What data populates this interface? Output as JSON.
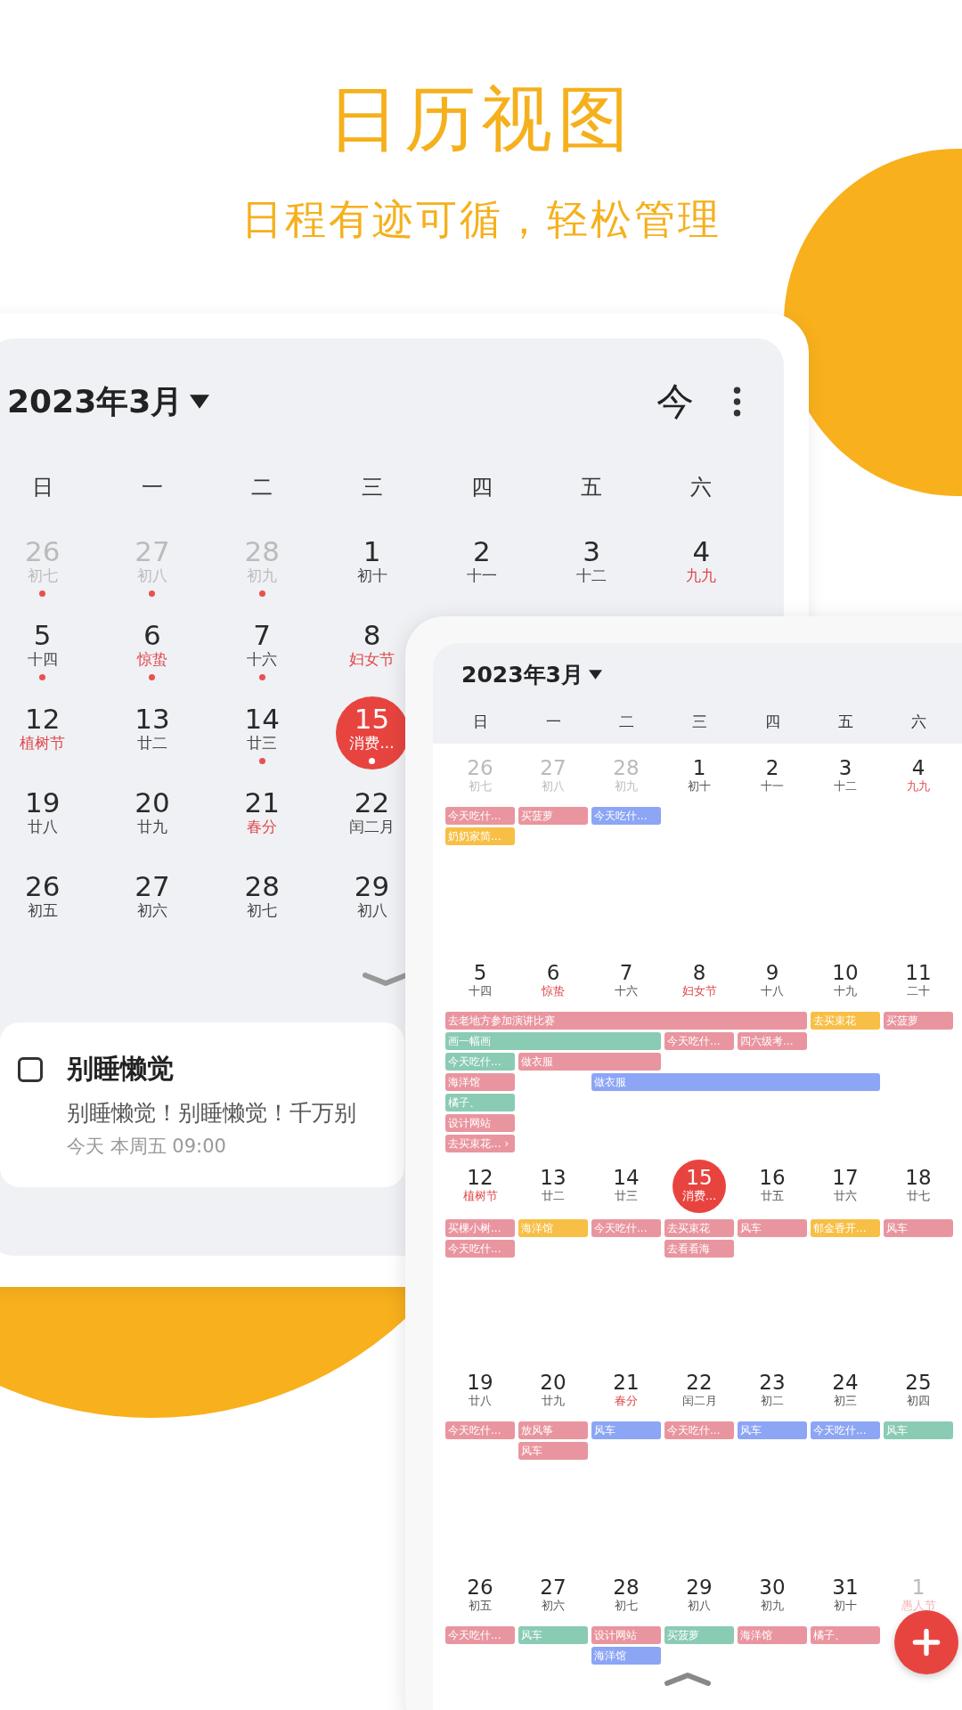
{
  "headline": "日历视图",
  "subheadline": "日程有迹可循，轻松管理",
  "month_view": {
    "title": "2023年3月",
    "today_button": "今",
    "weekdays": [
      "日",
      "一",
      "二",
      "三",
      "四",
      "五",
      "六"
    ],
    "weeks": [
      [
        {
          "day": "26",
          "lunar": "初七",
          "festival": false,
          "other_month": true,
          "dot": true,
          "selected": false
        },
        {
          "day": "27",
          "lunar": "初八",
          "festival": false,
          "other_month": true,
          "dot": true,
          "selected": false
        },
        {
          "day": "28",
          "lunar": "初九",
          "festival": false,
          "other_month": true,
          "dot": true,
          "selected": false
        },
        {
          "day": "1",
          "lunar": "初十",
          "festival": false,
          "other_month": false,
          "dot": false,
          "selected": false
        },
        {
          "day": "2",
          "lunar": "十一",
          "festival": false,
          "other_month": false,
          "dot": false,
          "selected": false
        },
        {
          "day": "3",
          "lunar": "十二",
          "festival": false,
          "other_month": false,
          "dot": false,
          "selected": false
        },
        {
          "day": "4",
          "lunar": "九九",
          "festival": true,
          "other_month": false,
          "dot": false,
          "selected": false
        }
      ],
      [
        {
          "day": "5",
          "lunar": "十四",
          "festival": false,
          "other_month": false,
          "dot": true,
          "selected": false
        },
        {
          "day": "6",
          "lunar": "惊蛰",
          "festival": true,
          "other_month": false,
          "dot": true,
          "selected": false
        },
        {
          "day": "7",
          "lunar": "十六",
          "festival": false,
          "other_month": false,
          "dot": true,
          "selected": false
        },
        {
          "day": "8",
          "lunar": "妇女节",
          "festival": true,
          "other_month": false,
          "dot": false,
          "selected": false
        }
      ],
      [
        {
          "day": "12",
          "lunar": "植树节",
          "festival": true,
          "other_month": false,
          "dot": false,
          "selected": false
        },
        {
          "day": "13",
          "lunar": "廿二",
          "festival": false,
          "other_month": false,
          "dot": false,
          "selected": false
        },
        {
          "day": "14",
          "lunar": "廿三",
          "festival": false,
          "other_month": false,
          "dot": true,
          "selected": false
        },
        {
          "day": "15",
          "lunar": "消费...",
          "festival": false,
          "other_month": false,
          "dot": true,
          "selected": true
        }
      ],
      [
        {
          "day": "19",
          "lunar": "廿八",
          "festival": false,
          "other_month": false,
          "dot": false,
          "selected": false
        },
        {
          "day": "20",
          "lunar": "廿九",
          "festival": false,
          "other_month": false,
          "dot": false,
          "selected": false
        },
        {
          "day": "21",
          "lunar": "春分",
          "festival": true,
          "other_month": false,
          "dot": false,
          "selected": false
        },
        {
          "day": "22",
          "lunar": "闰二月",
          "festival": false,
          "other_month": false,
          "dot": false,
          "selected": false
        }
      ],
      [
        {
          "day": "26",
          "lunar": "初五",
          "festival": false,
          "other_month": false,
          "dot": false,
          "selected": false
        },
        {
          "day": "27",
          "lunar": "初六",
          "festival": false,
          "other_month": false,
          "dot": false,
          "selected": false
        },
        {
          "day": "28",
          "lunar": "初七",
          "festival": false,
          "other_month": false,
          "dot": false,
          "selected": false
        },
        {
          "day": "29",
          "lunar": "初八",
          "festival": false,
          "other_month": false,
          "dot": false,
          "selected": false
        }
      ]
    ],
    "todo": {
      "checked": false,
      "title": "别睡懒觉",
      "description": "别睡懒觉！别睡懒觉！千万别",
      "time": "今天 本周五 09:00"
    }
  },
  "agenda_view": {
    "title": "2023年3月",
    "weekdays": [
      "日",
      "一",
      "二",
      "三",
      "四",
      "五",
      "六"
    ],
    "weeks": [
      {
        "days": [
          {
            "day": "26",
            "lunar": "初七",
            "festival": false,
            "other_month": true,
            "selected": false
          },
          {
            "day": "27",
            "lunar": "初八",
            "festival": false,
            "other_month": true,
            "selected": false
          },
          {
            "day": "28",
            "lunar": "初九",
            "festival": false,
            "other_month": true,
            "selected": false
          },
          {
            "day": "1",
            "lunar": "初十",
            "festival": false,
            "other_month": false,
            "selected": false
          },
          {
            "day": "2",
            "lunar": "十一",
            "festival": false,
            "other_month": false,
            "selected": false
          },
          {
            "day": "3",
            "lunar": "十二",
            "festival": false,
            "other_month": false,
            "selected": false
          },
          {
            "day": "4",
            "lunar": "九九",
            "festival": true,
            "other_month": false,
            "selected": false
          }
        ],
        "lanes": [
          [
            {
              "kind": "event",
              "text": "今天吃什...",
              "color": "#e9959f"
            },
            {
              "kind": "event",
              "text": "买菠萝",
              "color": "#e9959f"
            },
            {
              "kind": "event",
              "text": "今天吃什...",
              "color": "#8ca5f5"
            }
          ],
          [
            {
              "kind": "event",
              "text": "奶奶家简...",
              "color": "#f7bf45"
            }
          ]
        ]
      },
      {
        "days": [
          {
            "day": "5",
            "lunar": "十四",
            "festival": false,
            "other_month": false,
            "selected": false
          },
          {
            "day": "6",
            "lunar": "惊蛰",
            "festival": true,
            "other_month": false,
            "selected": false
          },
          {
            "day": "7",
            "lunar": "十六",
            "festival": false,
            "other_month": false,
            "selected": false
          },
          {
            "day": "8",
            "lunar": "妇女节",
            "festival": true,
            "other_month": false,
            "selected": false
          },
          {
            "day": "9",
            "lunar": "十八",
            "festival": false,
            "other_month": false,
            "selected": false
          },
          {
            "day": "10",
            "lunar": "十九",
            "festival": false,
            "other_month": false,
            "selected": false
          },
          {
            "day": "11",
            "lunar": "二十",
            "festival": false,
            "other_month": false,
            "selected": false
          }
        ],
        "lanes": [
          [
            {
              "kind": "event",
              "text": "去老地方参加演讲比赛",
              "color": "#e9959f"
            },
            {
              "kind": "continued"
            },
            {
              "kind": "continued"
            },
            {
              "kind": "continued"
            },
            {
              "kind": "continued"
            },
            {
              "kind": "event",
              "text": "去买束花",
              "color": "#f7bf45"
            },
            {
              "kind": "event",
              "text": "买菠萝",
              "color": "#e9959f"
            }
          ],
          [
            {
              "kind": "event",
              "text": "画一幅画",
              "color": "#8acbb4"
            },
            {
              "kind": "continued"
            },
            {
              "kind": "continued"
            },
            {
              "kind": "event",
              "text": "今天吃什...",
              "color": "#e9959f"
            },
            {
              "kind": "event",
              "text": "四六级考...",
              "color": "#e9959f"
            }
          ],
          [
            {
              "kind": "event",
              "text": "今天吃什...",
              "color": "#8acbb4"
            },
            {
              "kind": "event",
              "text": "做衣服",
              "color": "#e9959f"
            },
            {
              "kind": "continued"
            }
          ],
          [
            {
              "kind": "event",
              "text": "海洋馆",
              "color": "#e9959f"
            },
            {
              "kind": "empty"
            },
            {
              "kind": "event",
              "text": "做衣服",
              "color": "#8ca5f5"
            },
            {
              "kind": "continued"
            },
            {
              "kind": "continued"
            },
            {
              "kind": "continued"
            }
          ],
          [
            {
              "kind": "event",
              "text": "橘子、",
              "color": "#8acbb4"
            }
          ],
          [
            {
              "kind": "event",
              "text": "设计网站",
              "color": "#e9959f"
            }
          ],
          [
            {
              "kind": "event",
              "text": "去买束花...",
              "more": "›",
              "color": "#e9959f"
            }
          ]
        ]
      },
      {
        "days": [
          {
            "day": "12",
            "lunar": "植树节",
            "festival": true,
            "other_month": false,
            "selected": false
          },
          {
            "day": "13",
            "lunar": "廿二",
            "festival": false,
            "other_month": false,
            "selected": false
          },
          {
            "day": "14",
            "lunar": "廿三",
            "festival": false,
            "other_month": false,
            "selected": false
          },
          {
            "day": "15",
            "lunar": "消费...",
            "festival": false,
            "other_month": false,
            "selected": true
          },
          {
            "day": "16",
            "lunar": "廿五",
            "festival": false,
            "other_month": false,
            "selected": false
          },
          {
            "day": "17",
            "lunar": "廿六",
            "festival": false,
            "other_month": false,
            "selected": false
          },
          {
            "day": "18",
            "lunar": "廿七",
            "festival": false,
            "other_month": false,
            "selected": false
          }
        ],
        "lanes": [
          [
            {
              "kind": "event",
              "text": "买棵小树...",
              "color": "#e9959f"
            },
            {
              "kind": "event",
              "text": "海洋馆",
              "color": "#f7bf45"
            },
            {
              "kind": "event",
              "text": "今天吃什...",
              "color": "#e9959f"
            },
            {
              "kind": "event",
              "text": "去买束花",
              "color": "#e9959f"
            },
            {
              "kind": "event",
              "text": "风车",
              "color": "#e9959f"
            },
            {
              "kind": "event",
              "text": "郁金香开...",
              "color": "#f7bf45"
            },
            {
              "kind": "event",
              "text": "风车",
              "color": "#e9959f"
            }
          ],
          [
            {
              "kind": "event",
              "text": "今天吃什...",
              "color": "#e9959f"
            },
            {
              "kind": "empty"
            },
            {
              "kind": "empty"
            },
            {
              "kind": "event",
              "text": "去看看海",
              "color": "#e9959f"
            }
          ]
        ]
      },
      {
        "days": [
          {
            "day": "19",
            "lunar": "廿八",
            "festival": false,
            "other_month": false,
            "selected": false
          },
          {
            "day": "20",
            "lunar": "廿九",
            "festival": false,
            "other_month": false,
            "selected": false
          },
          {
            "day": "21",
            "lunar": "春分",
            "festival": true,
            "other_month": false,
            "selected": false
          },
          {
            "day": "22",
            "lunar": "闰二月",
            "festival": false,
            "other_month": false,
            "selected": false
          },
          {
            "day": "23",
            "lunar": "初二",
            "festival": false,
            "other_month": false,
            "selected": false
          },
          {
            "day": "24",
            "lunar": "初三",
            "festival": false,
            "other_month": false,
            "selected": false
          },
          {
            "day": "25",
            "lunar": "初四",
            "festival": false,
            "other_month": false,
            "selected": false
          }
        ],
        "lanes": [
          [
            {
              "kind": "event",
              "text": "今天吃什...",
              "color": "#e9959f"
            },
            {
              "kind": "event",
              "text": "放风筝",
              "color": "#e9959f"
            },
            {
              "kind": "event",
              "text": "风车",
              "color": "#8ca5f5"
            },
            {
              "kind": "event",
              "text": "今天吃什...",
              "color": "#e9959f"
            },
            {
              "kind": "event",
              "text": "风车",
              "color": "#8ca5f5"
            },
            {
              "kind": "event",
              "text": "今天吃什...",
              "color": "#8ca5f5"
            },
            {
              "kind": "event",
              "text": "风车",
              "color": "#8acbb4"
            }
          ],
          [
            {
              "kind": "empty"
            },
            {
              "kind": "event",
              "text": "风车",
              "color": "#e9959f"
            }
          ]
        ]
      },
      {
        "days": [
          {
            "day": "26",
            "lunar": "初五",
            "festival": false,
            "other_month": false,
            "selected": false
          },
          {
            "day": "27",
            "lunar": "初六",
            "festival": false,
            "other_month": false,
            "selected": false
          },
          {
            "day": "28",
            "lunar": "初七",
            "festival": false,
            "other_month": false,
            "selected": false
          },
          {
            "day": "29",
            "lunar": "初八",
            "festival": false,
            "other_month": false,
            "selected": false
          },
          {
            "day": "30",
            "lunar": "初九",
            "festival": false,
            "other_month": false,
            "selected": false
          },
          {
            "day": "31",
            "lunar": "初十",
            "festival": false,
            "other_month": false,
            "selected": false
          },
          {
            "day": "1",
            "lunar": "愚人节",
            "festival": true,
            "other_month": true,
            "selected": false
          }
        ],
        "lanes": [
          [
            {
              "kind": "event",
              "text": "今天吃什...",
              "color": "#e9959f"
            },
            {
              "kind": "event",
              "text": "风车",
              "color": "#8acbb4"
            },
            {
              "kind": "event",
              "text": "设计网站",
              "color": "#e9959f"
            },
            {
              "kind": "event",
              "text": "买菠萝",
              "color": "#8acbb4"
            },
            {
              "kind": "event",
              "text": "海洋馆",
              "color": "#e9959f"
            },
            {
              "kind": "event",
              "text": "橘子、",
              "color": "#e9959f"
            }
          ],
          [
            {
              "kind": "empty"
            },
            {
              "kind": "empty"
            },
            {
              "kind": "event",
              "text": "海洋馆",
              "color": "#8ca5f5"
            }
          ]
        ]
      }
    ]
  }
}
